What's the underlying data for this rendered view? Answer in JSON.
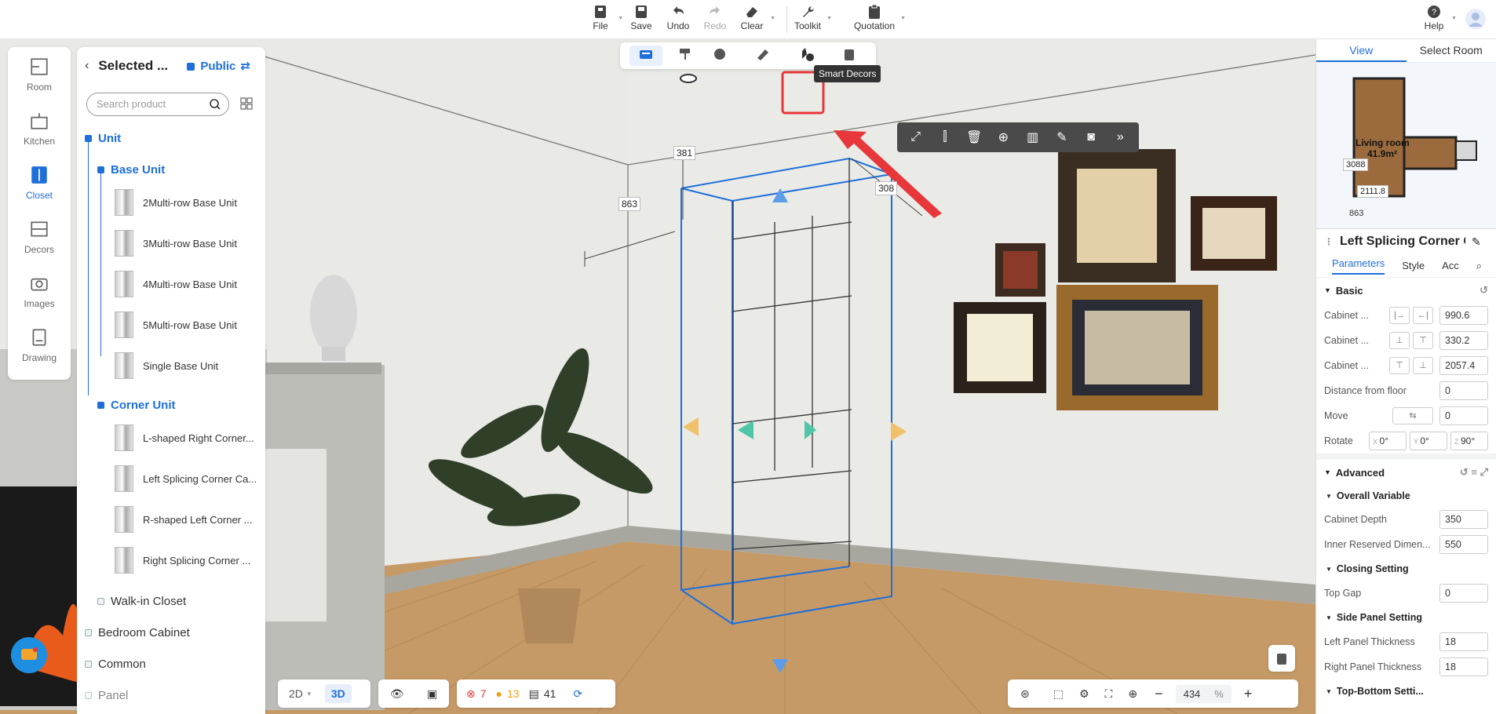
{
  "toolbar": {
    "file": "File",
    "save": "Save",
    "undo": "Undo",
    "redo": "Redo",
    "clear": "Clear",
    "toolkit": "Toolkit",
    "quotation": "Quotation",
    "help": "Help"
  },
  "tooltip": "Smart Decors",
  "rail": [
    {
      "label": "Room",
      "icon": "room-icon"
    },
    {
      "label": "Kitchen",
      "icon": "kitchen-icon"
    },
    {
      "label": "Closet",
      "icon": "closet-icon",
      "active": true
    },
    {
      "label": "Decors",
      "icon": "decors-icon"
    },
    {
      "label": "Images",
      "icon": "camera-icon"
    },
    {
      "label": "Drawing",
      "icon": "drawing-icon"
    }
  ],
  "catalog": {
    "title": "Selected ...",
    "scope": "Public",
    "search_placeholder": "Search product",
    "tree": {
      "unit": "Unit",
      "base_unit": "Base Unit",
      "base_items": [
        "2Multi-row Base Unit",
        "3Multi-row Base Unit",
        "4Multi-row Base Unit",
        "5Multi-row Base Unit",
        "Single Base Unit"
      ],
      "corner_unit": "Corner Unit",
      "corner_items": [
        "L-shaped Right Corner...",
        "Left Splicing Corner Ca...",
        "R-shaped Left Corner ...",
        "Right Splicing Corner ..."
      ],
      "walk_in": "Walk-in Closet",
      "bedroom": "Bedroom Cabinet",
      "common": "Common",
      "panel": "Panel"
    }
  },
  "dimensions": {
    "d1": "381",
    "d2": "863",
    "d3": "308"
  },
  "bottom": {
    "mode2d": "2D",
    "mode3d": "3D",
    "errors": "7",
    "warnings": "13",
    "items": "41",
    "zoom": "434",
    "zoom_unit": "%"
  },
  "right": {
    "tab_view": "View",
    "tab_select_room": "Select Room",
    "map": {
      "room_name": "Living room",
      "area": "41.9m²",
      "dim_a": "3088",
      "dim_b": "2111.8",
      "dim_c": "863"
    },
    "title": "Left Splicing Corner Ca...",
    "ptabs": [
      "Parameters",
      "Style",
      "Acc"
    ],
    "basic": "Basic",
    "rows": [
      {
        "label": "Cabinet ...",
        "value": "990.6"
      },
      {
        "label": "Cabinet ...",
        "value": "330.2"
      },
      {
        "label": "Cabinet ...",
        "value": "2057.4"
      },
      {
        "label": "Distance from floor",
        "value": "0"
      },
      {
        "label": "Move",
        "value": "0"
      }
    ],
    "rotate": {
      "label": "Rotate",
      "x": "0°",
      "y": "0°",
      "z": "90°"
    },
    "advanced": "Advanced",
    "overall": "Overall Variable",
    "cabinet_depth": {
      "label": "Cabinet Depth",
      "value": "350"
    },
    "inner_reserved": {
      "label": "Inner Reserved Dimen...",
      "value": "550"
    },
    "closing": "Closing Setting",
    "top_gap": {
      "label": "Top Gap",
      "value": "0"
    },
    "side_panel": "Side Panel Setting",
    "left_panel": {
      "label": "Left Panel Thickness",
      "value": "18"
    },
    "right_panel": {
      "label": "Right Panel Thickness",
      "value": "18"
    },
    "top_bottom": "Top-Bottom Setti..."
  },
  "colors": {
    "accent": "#1e6fd9",
    "highlight": "#e8373a"
  }
}
